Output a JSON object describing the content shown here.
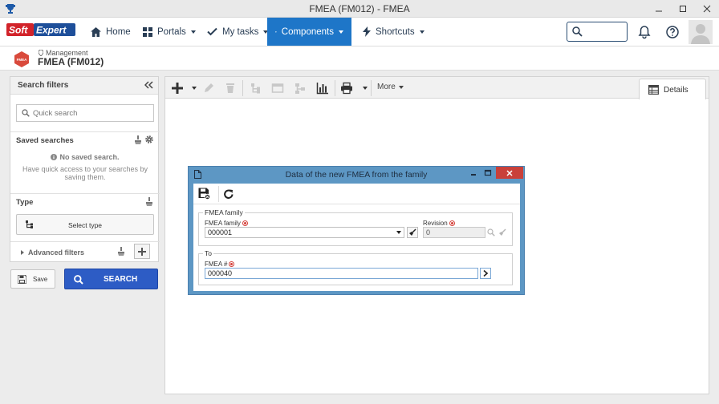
{
  "window": {
    "title": "FMEA (FM012) - FMEA"
  },
  "nav": {
    "logo": "Soft Expert",
    "items": [
      {
        "label": "Home",
        "icon": "home-icon"
      },
      {
        "label": "Portals",
        "icon": "grid-icon"
      },
      {
        "label": "My tasks",
        "icon": "check-icon"
      },
      {
        "label": "Components",
        "icon": "trophy-icon"
      },
      {
        "label": "Shortcuts",
        "icon": "bolt-icon"
      }
    ],
    "search_value": ""
  },
  "header": {
    "badge": "FMEA",
    "breadcrumb": "Management",
    "title": "FMEA (FM012)"
  },
  "filters": {
    "title": "Search filters",
    "quick_search_placeholder": "Quick search",
    "saved_searches_label": "Saved searches",
    "no_saved": "No saved search.",
    "no_saved_hint_1": "Have quick access to your searches by",
    "no_saved_hint_2": "saving them.",
    "type_label": "Type",
    "select_type": "Select type",
    "advanced_filters": "Advanced filters",
    "save_label": "Save",
    "search_label": "SEARCH"
  },
  "toolbar": {
    "more_label": "More",
    "details_tab": "Details"
  },
  "dialog": {
    "title": "Data of the new FMEA from the family",
    "family_group": "FMEA family",
    "family_label": "FMEA family",
    "family_value": "000001",
    "revision_label": "Revision",
    "revision_value": "0",
    "to_group": "To",
    "fmea_number_label": "FMEA #",
    "fmea_number_value": "000040"
  },
  "colors": {
    "accent": "#1e76c8",
    "search_button": "#2d5cc5",
    "dialog_frame": "#5d97c4",
    "close_red": "#c9403a",
    "required": "#d4403a"
  }
}
